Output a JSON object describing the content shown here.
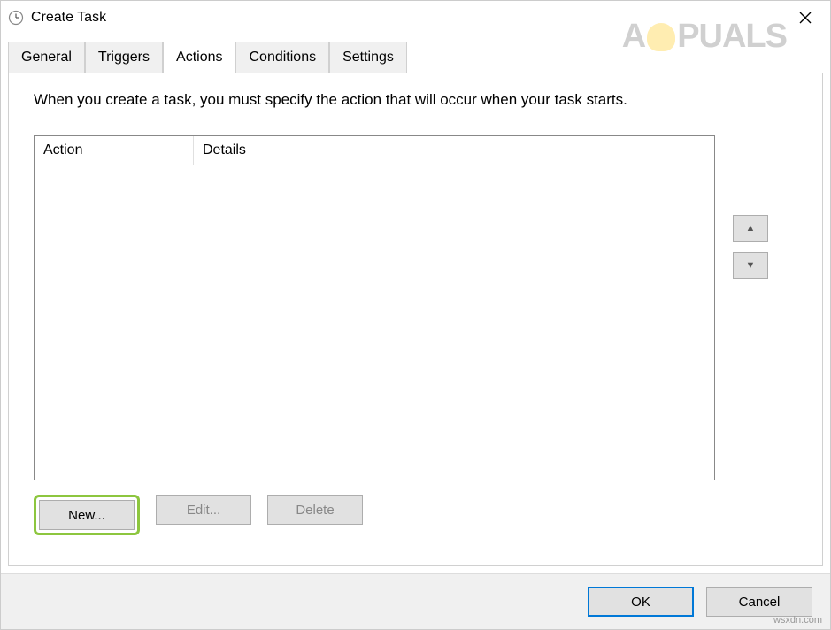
{
  "window": {
    "title": "Create Task"
  },
  "tabs": {
    "general": "General",
    "triggers": "Triggers",
    "actions": "Actions",
    "conditions": "Conditions",
    "settings": "Settings"
  },
  "content": {
    "instruction": "When you create a task, you must specify the action that will occur when your task starts.",
    "columns": {
      "action": "Action",
      "details": "Details"
    }
  },
  "buttons": {
    "new": "New...",
    "edit": "Edit...",
    "delete": "Delete",
    "ok": "OK",
    "cancel": "Cancel",
    "up": "▲",
    "down": "▼"
  },
  "watermark": {
    "brand_left": "A",
    "brand_right": "PUALS",
    "site": "wsxdn.com"
  }
}
